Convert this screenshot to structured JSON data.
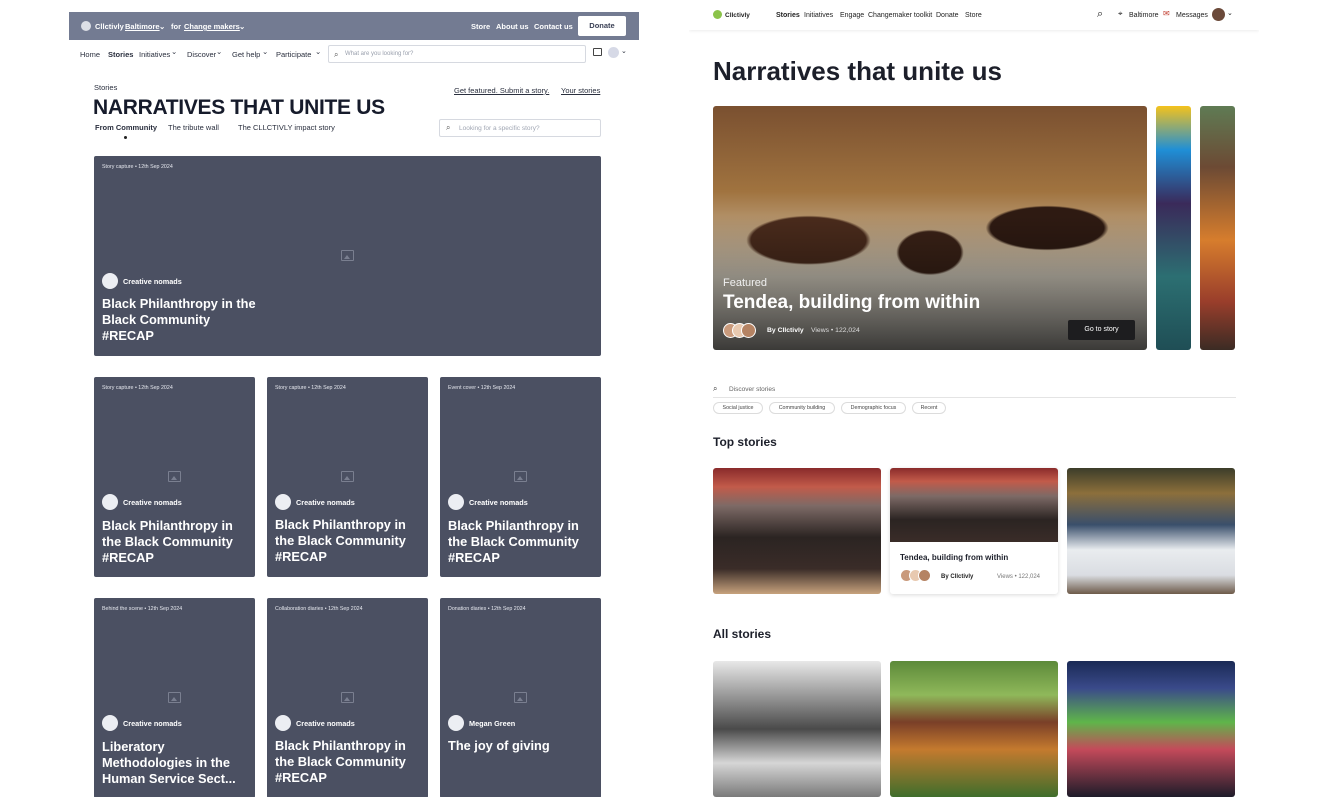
{
  "left": {
    "topbar": {
      "brand": "Cllctivly",
      "city": "Baltimore",
      "for_text": "for",
      "audience": "Change makers",
      "links": [
        "Store",
        "About us",
        "Contact us"
      ],
      "donate": "Donate"
    },
    "nav": {
      "items": [
        "Home",
        "Stories",
        "Initiatives",
        "Discover",
        "Get help",
        "Participate"
      ],
      "search_placeholder": "What are you looking for?"
    },
    "breadcrumb": "Stories",
    "title": "NARRATIVES THAT UNITE US",
    "right_links": [
      "Get featured. Submit a story.",
      "Your stories"
    ],
    "tabs": [
      "From Community",
      "The tribute wall",
      "The CLLCTIVLY impact story"
    ],
    "story_search_placeholder": "Looking for a specific story?",
    "cards": [
      {
        "meta": "Story capture •  12th Sep 2024",
        "author": "Creative nomads",
        "title": "Black Philanthropy in the Black Community #RECAP"
      },
      {
        "meta": "Story capture •  12th Sep 2024",
        "author": "Creative nomads",
        "title": "Black Philanthropy in the Black Community #RECAP"
      },
      {
        "meta": "Story capture •  12th Sep 2024",
        "author": "Creative nomads",
        "title": "Black Philanthropy in the Black Community #RECAP"
      },
      {
        "meta": "Event cover •  12th Sep 2024",
        "author": "Creative nomads",
        "title": "Black Philanthropy in the Black Community #RECAP"
      },
      {
        "meta": "Behind the scene •  12th Sep 2024",
        "author": "Creative nomads",
        "title": "Liberatory Methodologies in the Human Service Sect..."
      },
      {
        "meta": "Collaboration diaries •  12th Sep 2024",
        "author": "Creative nomads",
        "title": "Black Philanthropy in the Black Community #RECAP"
      },
      {
        "meta": "Donation diaries •  12th Sep 2024",
        "author": "Megan Green",
        "title": "The joy of giving"
      }
    ]
  },
  "right": {
    "header": {
      "brand": "Cllctivly",
      "nav": [
        "Stories",
        "Initiatives",
        "Engage",
        "Changemaker toolkit",
        "Donate",
        "Store"
      ],
      "city": "Baltimore",
      "messages": "Messages"
    },
    "title": "Narratives that unite us",
    "hero": {
      "featured": "Featured",
      "title": "Tendea, building from within",
      "by": "By Cllctivly",
      "views": "Views  •  122,024",
      "cta": "Go to story"
    },
    "discover_placeholder": "Discover stories",
    "chips": [
      "Social justice",
      "Community building",
      "Demographic focus",
      "Recent"
    ],
    "top_stories": "Top stories",
    "top_card": {
      "title": "Tendea, building from within",
      "by": "By Cllctivly",
      "views": "Views  •  122,024"
    },
    "all_stories": "All stories"
  }
}
